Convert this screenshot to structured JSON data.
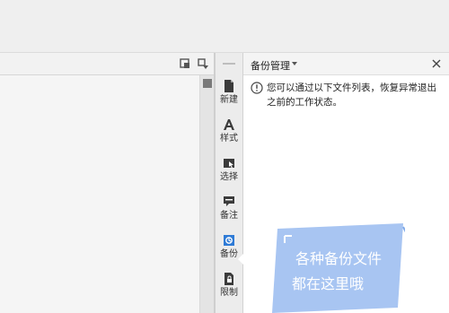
{
  "sidebar": {
    "items": [
      {
        "label": "新建",
        "icon": "new-document-icon"
      },
      {
        "label": "样式",
        "icon": "style-icon"
      },
      {
        "label": "选择",
        "icon": "select-icon"
      },
      {
        "label": "备注",
        "icon": "comment-icon"
      },
      {
        "label": "备份",
        "icon": "backup-icon"
      },
      {
        "label": "限制",
        "icon": "restrict-icon"
      }
    ]
  },
  "panel": {
    "title": "备份管理",
    "message": "您可以通过以下文件列表，恢复异常退出之前的工作状态。",
    "illustration_line1": "各种备份文件",
    "illustration_line2": "都在这里哦"
  },
  "colors": {
    "accent": "#2f7bd6",
    "illustration": "#a8c5f2"
  }
}
